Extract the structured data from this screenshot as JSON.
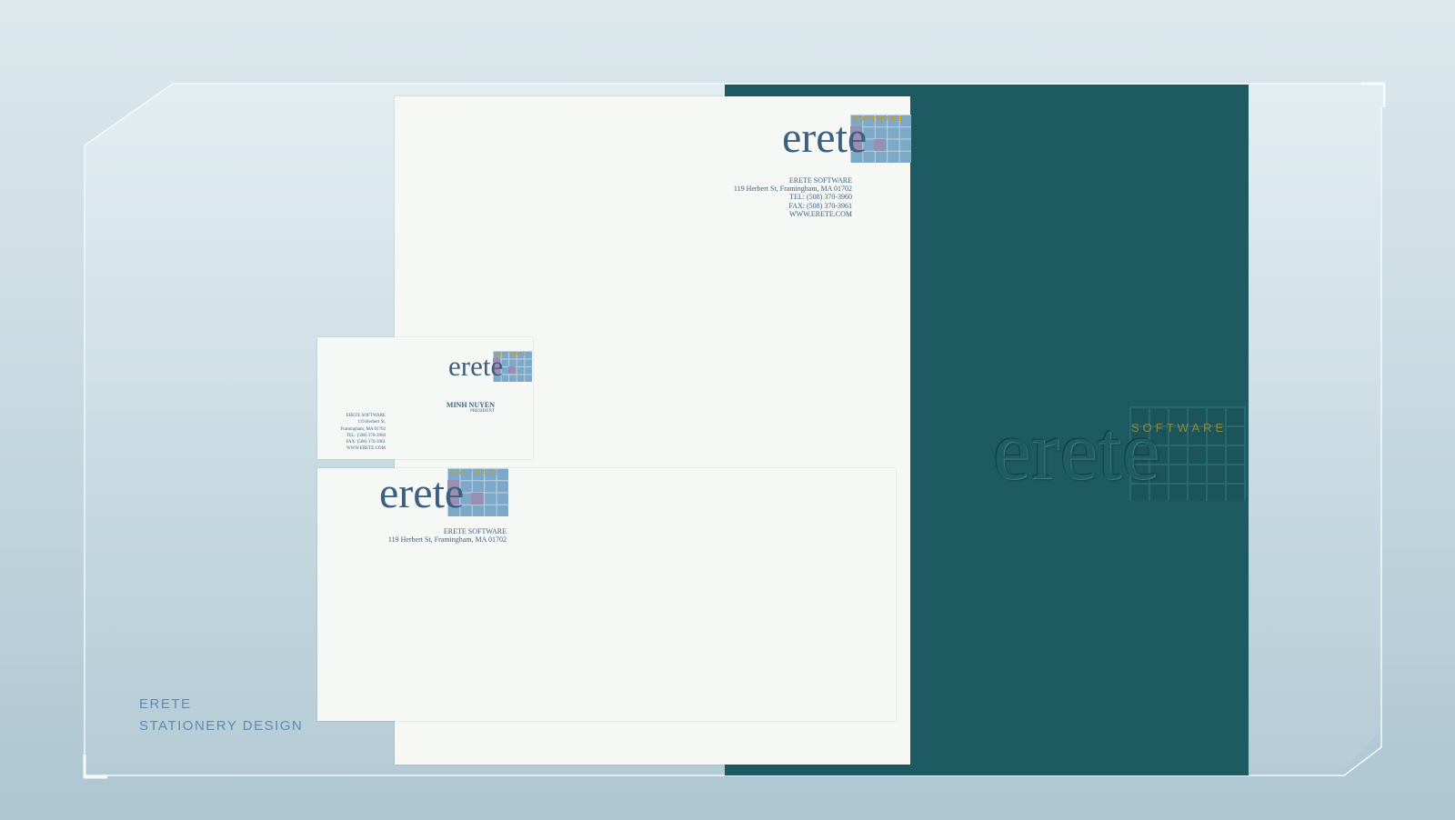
{
  "folder": {
    "logo_word": "erete",
    "logo_sub": "SOFTWARE",
    "color": "#1e5a61"
  },
  "letterhead": {
    "logo_word": "erete",
    "logo_sub": "SOFTWARE",
    "address_lines": [
      "ERETE SOFTWARE",
      "119 Herbert St, Framingham, MA 01702",
      "TEL: (508) 370-3960",
      "FAX: (508) 370-3961",
      "WWW.ERETE.COM"
    ]
  },
  "card": {
    "logo_word": "erete",
    "logo_sub": "SOFTWARE",
    "name": "MINH NUYEN",
    "title": "PRESIDENT",
    "address_lines": [
      "ERETE SOFTWARE",
      "119 Herbert St,",
      "Framingham, MA 01702",
      "TEL: (508) 370-3960",
      "FAX: (508) 370-3961",
      "WWW.ERETE.COM"
    ]
  },
  "envelope": {
    "logo_word": "erete",
    "logo_sub": "SOFTWARE",
    "address_lines": [
      "ERETE SOFTWARE",
      "119 Herbert St, Framingham, MA 01702"
    ]
  },
  "caption": {
    "line1": "ERETE",
    "line2": "STATIONERY DESIGN"
  }
}
